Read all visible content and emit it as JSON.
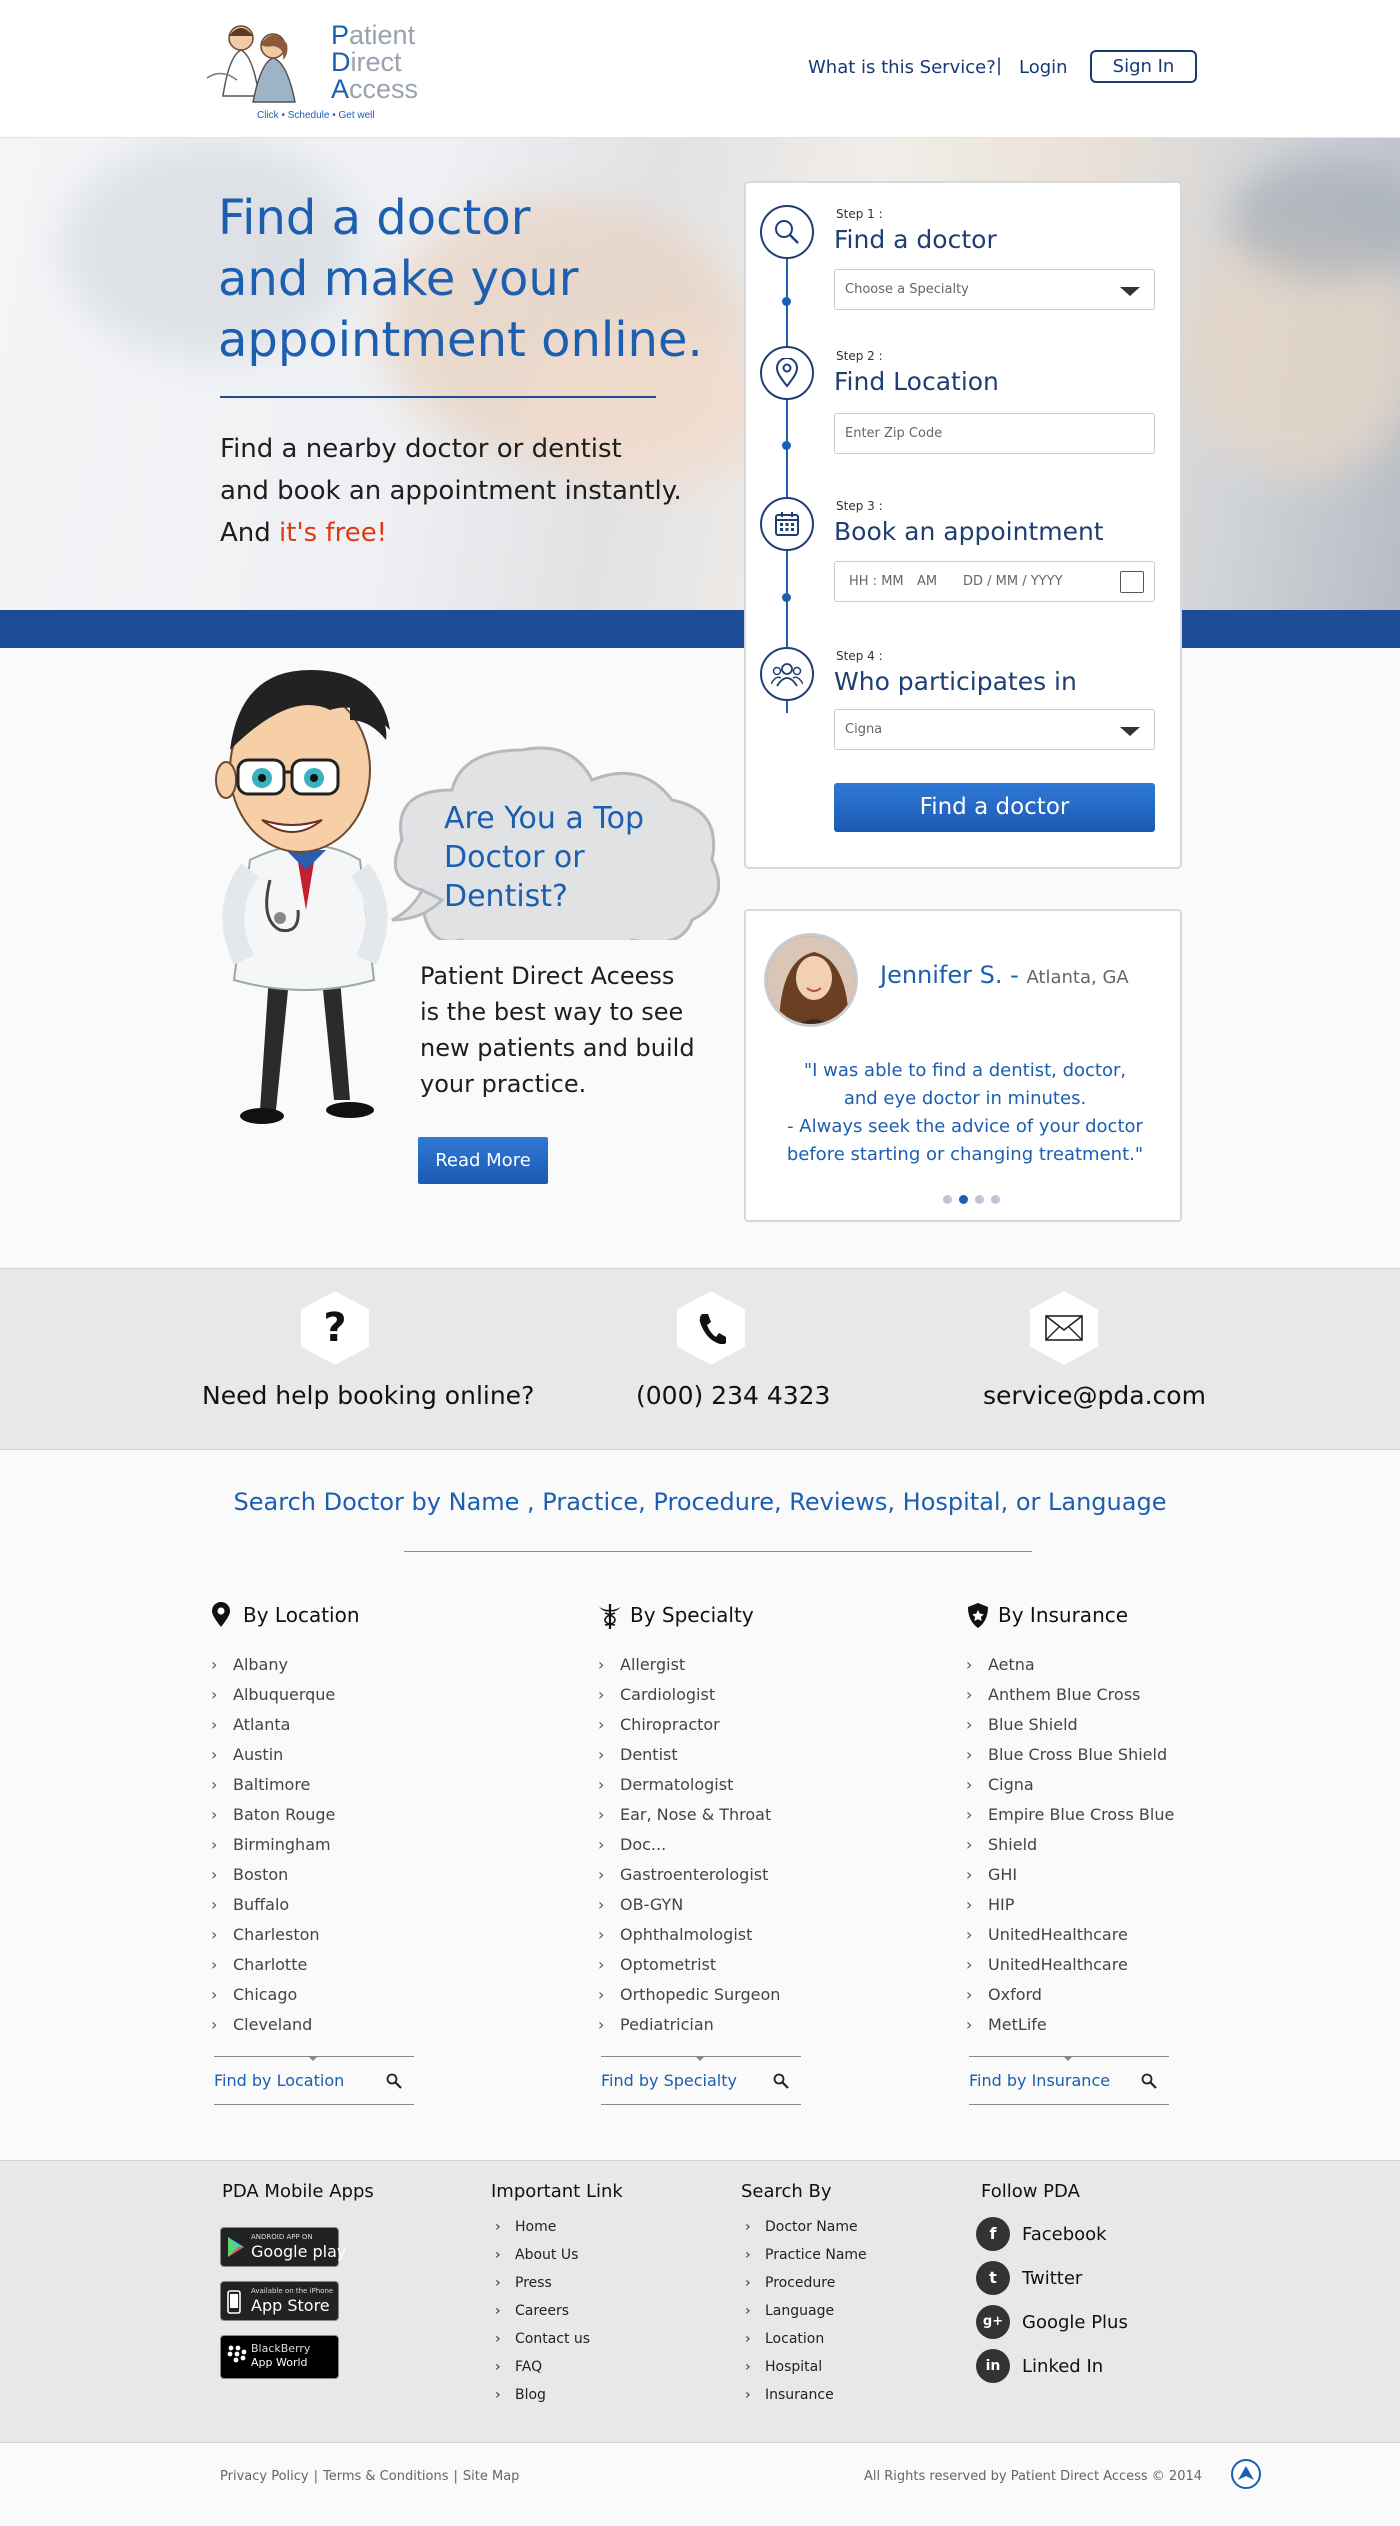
{
  "header": {
    "logo_words": [
      "Patient",
      "Direct",
      "Access"
    ],
    "logo_tagline": "Click • Schedule • Get well",
    "nav_service": "What is this Service?",
    "nav_sep": "|",
    "nav_login": "Login",
    "nav_signin": "Sign In"
  },
  "hero": {
    "title_lines": [
      "Find a doctor",
      "and make your",
      "appointment online."
    ],
    "sub_lines": [
      "Find a nearby doctor or dentist",
      "and book an appointment instantly."
    ],
    "sub_and": "And ",
    "sub_free": "it's free!",
    "free_color": "#e03a12"
  },
  "booking": {
    "steps": [
      {
        "label": "Step 1 :",
        "title": "Find a doctor",
        "icon": "search-icon",
        "field": "Choose a Specialty"
      },
      {
        "label": "Step 2 :",
        "title": "Find Location",
        "icon": "location-pin-icon",
        "field": "Enter Zip Code"
      },
      {
        "label": "Step 3 :",
        "title": "Book an appointment",
        "icon": "calendar-icon",
        "field_time": "HH : MM",
        "field_ampm": "AM",
        "field_date": "DD / MM / YYYY"
      },
      {
        "label": "Step 4 :",
        "title": "Who participates in",
        "icon": "group-icon",
        "field": "Cigna"
      }
    ],
    "submit": "Find a doctor",
    "accent": "#1c5eb0"
  },
  "promo": {
    "cloud_text": "Are You a Top Doctor or Dentist?",
    "body": "Patient Direct Aceess is the best way to see new patients and build your practice.",
    "button": "Read More"
  },
  "testimonial": {
    "name": "Jennifer S. - ",
    "location": "Atlanta, GA",
    "quote_lines": [
      "\"I was able to find a dentist, doctor,",
      "and eye doctor in minutes.",
      "- Always seek the advice of your doctor",
      "before starting or changing treatment.\""
    ],
    "active_dot": 1
  },
  "contact": {
    "help": "Need help booking online?",
    "phone": "(000) 234 4323",
    "email": "service@pda.com"
  },
  "search": {
    "title": "Search Doctor by Name , Practice, Procedure, Reviews, Hospital, or Language",
    "columns": [
      {
        "heading": "By Location",
        "icon": "location-pin-icon",
        "items": [
          "Albany",
          "Albuquerque",
          "Atlanta",
          "Austin",
          "Baltimore",
          "Baton Rouge",
          "Birmingham",
          "Boston",
          "Buffalo",
          "Charleston",
          "Charlotte",
          "Chicago",
          "Cleveland"
        ],
        "footer": "Find by Location"
      },
      {
        "heading": "By Specialty",
        "icon": "caduceus-icon",
        "items": [
          "Allergist",
          "Cardiologist",
          "Chiropractor",
          "Dentist",
          "Dermatologist",
          "Ear, Nose & Throat",
          "Doc...",
          "Gastroenterologist",
          "OB-GYN",
          "Ophthalmologist",
          "Optometrist",
          "Orthopedic Surgeon",
          "Pediatrician"
        ],
        "footer": "Find by Specialty"
      },
      {
        "heading": "By Insurance",
        "icon": "shield-icon",
        "items": [
          "Aetna",
          "Anthem Blue Cross",
          "Blue Shield",
          "Blue Cross Blue Shield",
          "Cigna",
          "Empire Blue Cross Blue",
          "Shield",
          "GHI",
          "HIP",
          "UnitedHealthcare",
          "UnitedHealthcare",
          "Oxford",
          "MetLife"
        ],
        "footer": "Find by Insurance"
      }
    ]
  },
  "footer": {
    "apps_title": "PDA Mobile Apps",
    "apps": [
      {
        "small": "ANDROID APP ON",
        "large": "Google play",
        "icon": "google-play-icon"
      },
      {
        "small": "Available on the iPhone",
        "large": "App Store",
        "icon": "apple-phone-icon"
      },
      {
        "small": "BlackBerry",
        "large": "App World",
        "icon": "blackberry-icon"
      }
    ],
    "links_title": "Important Link",
    "links": [
      "Home",
      "About Us",
      "Press",
      "Careers",
      "Contact us",
      "FAQ",
      "Blog"
    ],
    "search_title": "Search By",
    "search_links": [
      "Doctor Name",
      "Practice Name",
      "Procedure",
      "Language",
      "Location",
      "Hospital",
      "Insurance"
    ],
    "follow_title": "Follow PDA",
    "social": [
      {
        "label": "Facebook",
        "glyph": "f",
        "icon": "facebook-icon"
      },
      {
        "label": "Twitter",
        "glyph": "t",
        "icon": "twitter-icon"
      },
      {
        "label": "Google Plus",
        "glyph": "g+",
        "icon": "google-plus-icon"
      },
      {
        "label": "Linked In",
        "glyph": "in",
        "icon": "linkedin-icon"
      }
    ]
  },
  "bottom": {
    "legal": [
      "Privacy Policy",
      "Terms & Conditions",
      "Site Map"
    ],
    "legal_sep": "|",
    "copyright": "All Rights reserved by Patient Direct Access © 2014"
  }
}
